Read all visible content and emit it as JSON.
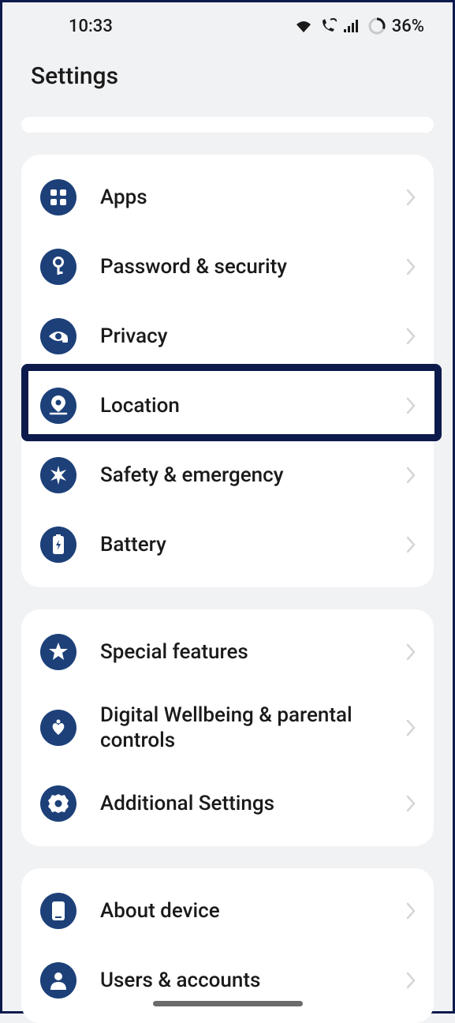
{
  "statusbar": {
    "time": "10:33",
    "battery_text": "36%"
  },
  "header": {
    "title": "Settings"
  },
  "groups": [
    {
      "items": [
        {
          "icon": "apps",
          "label": "Apps"
        },
        {
          "icon": "key",
          "label": "Password & security"
        },
        {
          "icon": "privacy",
          "label": "Privacy"
        },
        {
          "icon": "location",
          "label": "Location",
          "highlighted": true
        },
        {
          "icon": "emergency",
          "label": "Safety & emergency"
        },
        {
          "icon": "battery",
          "label": "Battery"
        }
      ]
    },
    {
      "items": [
        {
          "icon": "star",
          "label": "Special features"
        },
        {
          "icon": "heart",
          "label": "Digital Wellbeing & parental controls"
        },
        {
          "icon": "gear",
          "label": "Additional Settings"
        }
      ]
    },
    {
      "items": [
        {
          "icon": "device",
          "label": "About device"
        },
        {
          "icon": "user",
          "label": "Users & accounts"
        }
      ]
    }
  ]
}
